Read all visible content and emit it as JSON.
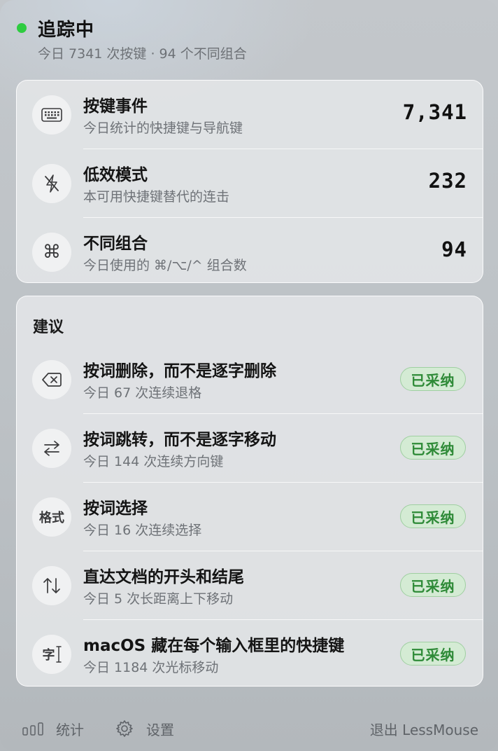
{
  "header": {
    "status_title": "追踪中",
    "status_subtitle": "今日 7341 次按键 · 94 个不同组合",
    "status_color": "#2ecc40"
  },
  "stats": [
    {
      "icon": "keyboard-icon",
      "title": "按键事件",
      "subtitle": "今日统计的快捷键与导航键",
      "value": "7,341"
    },
    {
      "icon": "lightning-off-icon",
      "title": "低效模式",
      "subtitle": "本可用快捷键替代的连击",
      "value": "232"
    },
    {
      "icon": "command-icon",
      "title": "不同组合",
      "subtitle": "今日使用的 ⌘/⌥/^ 组合数",
      "value": "94"
    }
  ],
  "suggestions": {
    "heading": "建议",
    "items": [
      {
        "icon": "delete-backward-icon",
        "title": "按词删除，而不是逐字删除",
        "subtitle": "今日 67 次连续退格",
        "badge": "已采纳"
      },
      {
        "icon": "arrows-left-right-icon",
        "title": "按词跳转，而不是逐字移动",
        "subtitle": "今日 144 次连续方向键",
        "badge": "已采纳"
      },
      {
        "icon": "format-icon",
        "icon_text": "格式",
        "title": "按词选择",
        "subtitle": "今日 16 次连续选择",
        "badge": "已采纳"
      },
      {
        "icon": "arrows-up-down-icon",
        "title": "直达文档的开头和结尾",
        "subtitle": "今日 5 次长距离上下移动",
        "badge": "已采纳"
      },
      {
        "icon": "text-cursor-icon",
        "icon_text": "字",
        "title": "macOS 藏在每个输入框里的快捷键",
        "subtitle": "今日 1184 次光标移动",
        "badge": "已采纳"
      }
    ]
  },
  "footer": {
    "stats_label": "统计",
    "settings_label": "设置",
    "quit_label": "退出 LessMouse"
  },
  "colors": {
    "badge_text": "#2e8a37",
    "badge_bg": "#d4ebd4",
    "badge_border": "#9fcfa1"
  }
}
